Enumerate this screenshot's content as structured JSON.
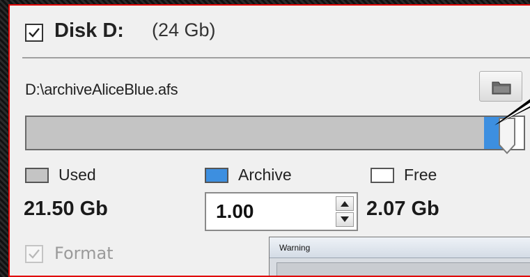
{
  "disk": {
    "title": "Disk D:",
    "size": "(24 Gb)",
    "checked": true
  },
  "path": {
    "value": "D:\\archiveAliceBlue.afs"
  },
  "browse_icon": "folder-icon",
  "slider": {
    "used_fraction": 0.92,
    "archive_fraction": 0.043,
    "free_fraction": 0.037
  },
  "legend": {
    "used_label": "Used",
    "archive_label": "Archive",
    "free_label": "Free"
  },
  "values": {
    "used": "21.50 Gb",
    "archive": "1.00",
    "free": "2.07 Gb"
  },
  "format": {
    "label": "Format",
    "checked": true,
    "enabled": false
  },
  "warning_window": {
    "title": "Warning"
  },
  "colors": {
    "used": "#c4c4c4",
    "archive": "#3d8fe0",
    "free": "#ffffff",
    "frame_border": "#e00000"
  }
}
